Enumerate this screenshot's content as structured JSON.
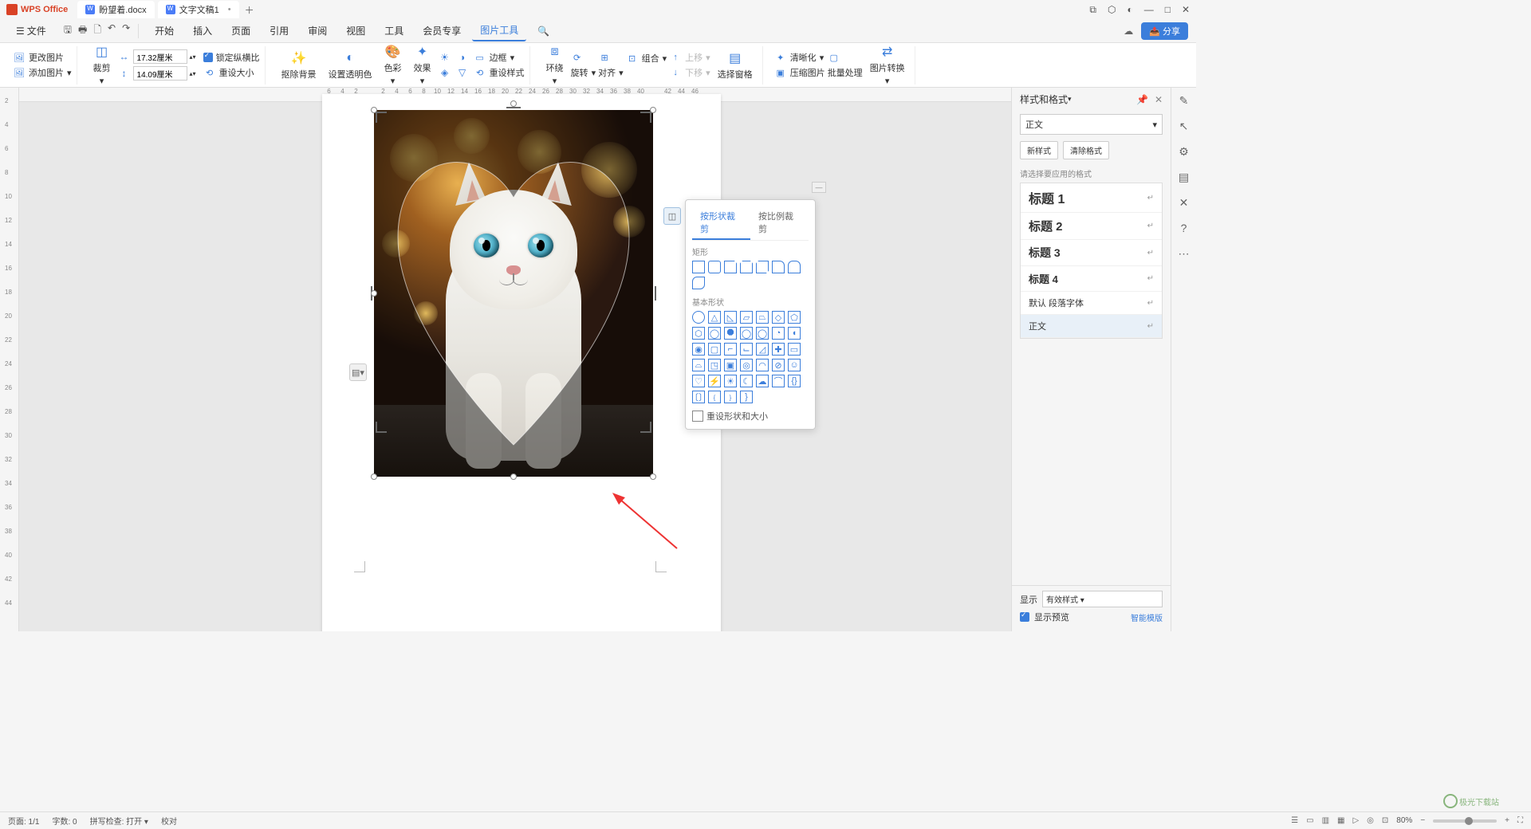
{
  "app": {
    "name": "WPS Office"
  },
  "tabs": [
    {
      "label": "盼望着.docx"
    },
    {
      "label": "文字文稿1"
    }
  ],
  "menu": {
    "file": "文件",
    "items": [
      "开始",
      "插入",
      "页面",
      "引用",
      "审阅",
      "视图",
      "工具",
      "会员专享",
      "图片工具"
    ],
    "share": "分享"
  },
  "ribbon": {
    "change_pic": "更改图片",
    "add_pic": "添加图片",
    "crop": "裁剪",
    "width": "17.32厘米",
    "height": "14.09厘米",
    "lock_ratio": "锁定纵横比",
    "reset_size": "重设大小",
    "rm_bg": "抠除背景",
    "set_trans": "设置透明色",
    "color": "色彩",
    "effect": "效果",
    "border": "边框",
    "reset_style": "重设样式",
    "wrap": "环绕",
    "rotate": "旋转",
    "align": "对齐",
    "group": "组合",
    "up": "上移",
    "down": "下移",
    "sel_pane": "选择窗格",
    "sharpen": "清晰化",
    "compress": "压缩图片",
    "batch": "批量处理",
    "convert": "图片转换"
  },
  "crop_popup": {
    "tab_shape": "按形状裁剪",
    "tab_ratio": "按比例裁剪",
    "sec_rect": "矩形",
    "sec_basic": "基本形状",
    "reset": "重设形状和大小"
  },
  "panel": {
    "title": "样式和格式",
    "style_name": "正文",
    "new_style": "新样式",
    "clear_fmt": "清除格式",
    "hint": "请选择要应用的格式",
    "styles": [
      {
        "cls": "h1",
        "label": "标题 1"
      },
      {
        "cls": "h2",
        "label": "标题 2"
      },
      {
        "cls": "h3",
        "label": "标题 3"
      },
      {
        "cls": "h4",
        "label": "标题 4"
      },
      {
        "cls": "normal",
        "label": "默认 段落字体"
      },
      {
        "cls": "normal",
        "label": "正文"
      }
    ],
    "show_label": "显示",
    "show_value": "有效样式",
    "preview": "显示预览",
    "smart_tpl": "智能模版"
  },
  "status": {
    "page": "页面: 1/1",
    "words": "字数: 0",
    "spell": "拼写检查: 打开",
    "proof": "校对",
    "zoom": "80%"
  },
  "ruler_h": [
    "6",
    "4",
    "2",
    "",
    "2",
    "4",
    "6",
    "8",
    "10",
    "12",
    "14",
    "16",
    "18",
    "20",
    "22",
    "24",
    "26",
    "28",
    "30",
    "32",
    "34",
    "36",
    "38",
    "40",
    "",
    "42",
    "44",
    "46"
  ],
  "ruler_v": [
    "2",
    "4",
    "6",
    "8",
    "10",
    "12",
    "14",
    "16",
    "18",
    "20",
    "22",
    "24",
    "26",
    "28",
    "30",
    "32",
    "34",
    "36",
    "38",
    "40",
    "42",
    "44"
  ]
}
